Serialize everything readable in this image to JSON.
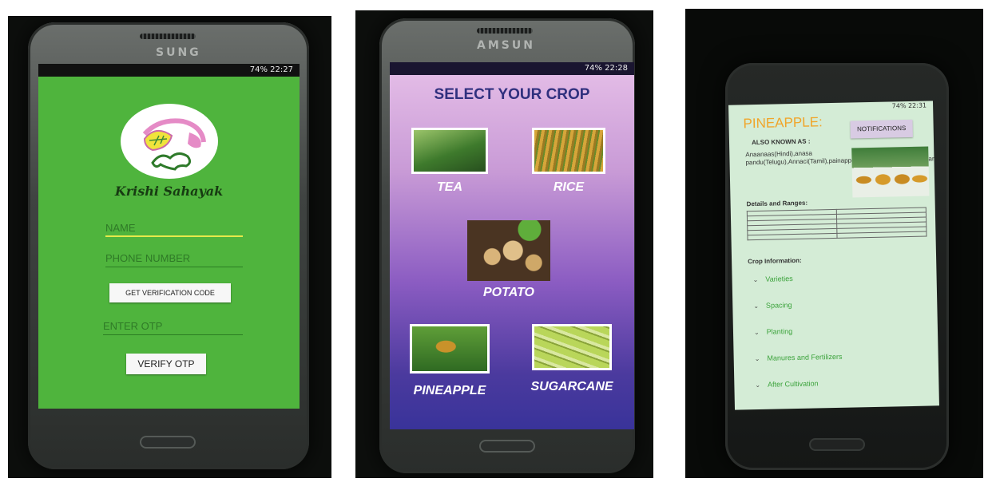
{
  "screens": [
    {
      "status": {
        "text": "74% 22:27"
      },
      "brand": "SUNG",
      "app_name": "Krishi Sahayak",
      "fields": {
        "name_placeholder": "NAME",
        "phone_placeholder": "PHONE NUMBER",
        "otp_placeholder": "ENTER OTP"
      },
      "buttons": {
        "get_code": "GET VERIFICATION CODE",
        "verify": "VERIFY OTP"
      }
    },
    {
      "status": {
        "text": "74% 22:28"
      },
      "brand": "AMSUN",
      "title": "SELECT YOUR CROP",
      "crops": [
        "TEA",
        "RICE",
        "POTATO",
        "PINEAPPLE",
        "SUGARCANE"
      ]
    },
    {
      "status": {
        "text": "74% 22:31"
      },
      "title": "PINEAPPLE:",
      "notifications_label": "NOTIFICATIONS",
      "aka_heading": "ALSO KNOWN AS :",
      "aka_text": "Anaanaas(Hindi),anasa pandu(Telugu),Annaci(Tamil),painappil(Malayalam),Anenasa(Gujarati),Ananasa(Marathi).",
      "details_heading": "Details and Ranges:",
      "crop_info_heading": "Crop Information:",
      "info_items": [
        "Varieties",
        "Spacing",
        "Planting",
        "Manures and Fertilizers",
        "After Cultivation"
      ]
    }
  ],
  "colors": {
    "login_bg": "#4fb43d",
    "crop_title": "#30307e",
    "pineapple_title": "#f0a52a",
    "info_link": "#3aa23a"
  }
}
